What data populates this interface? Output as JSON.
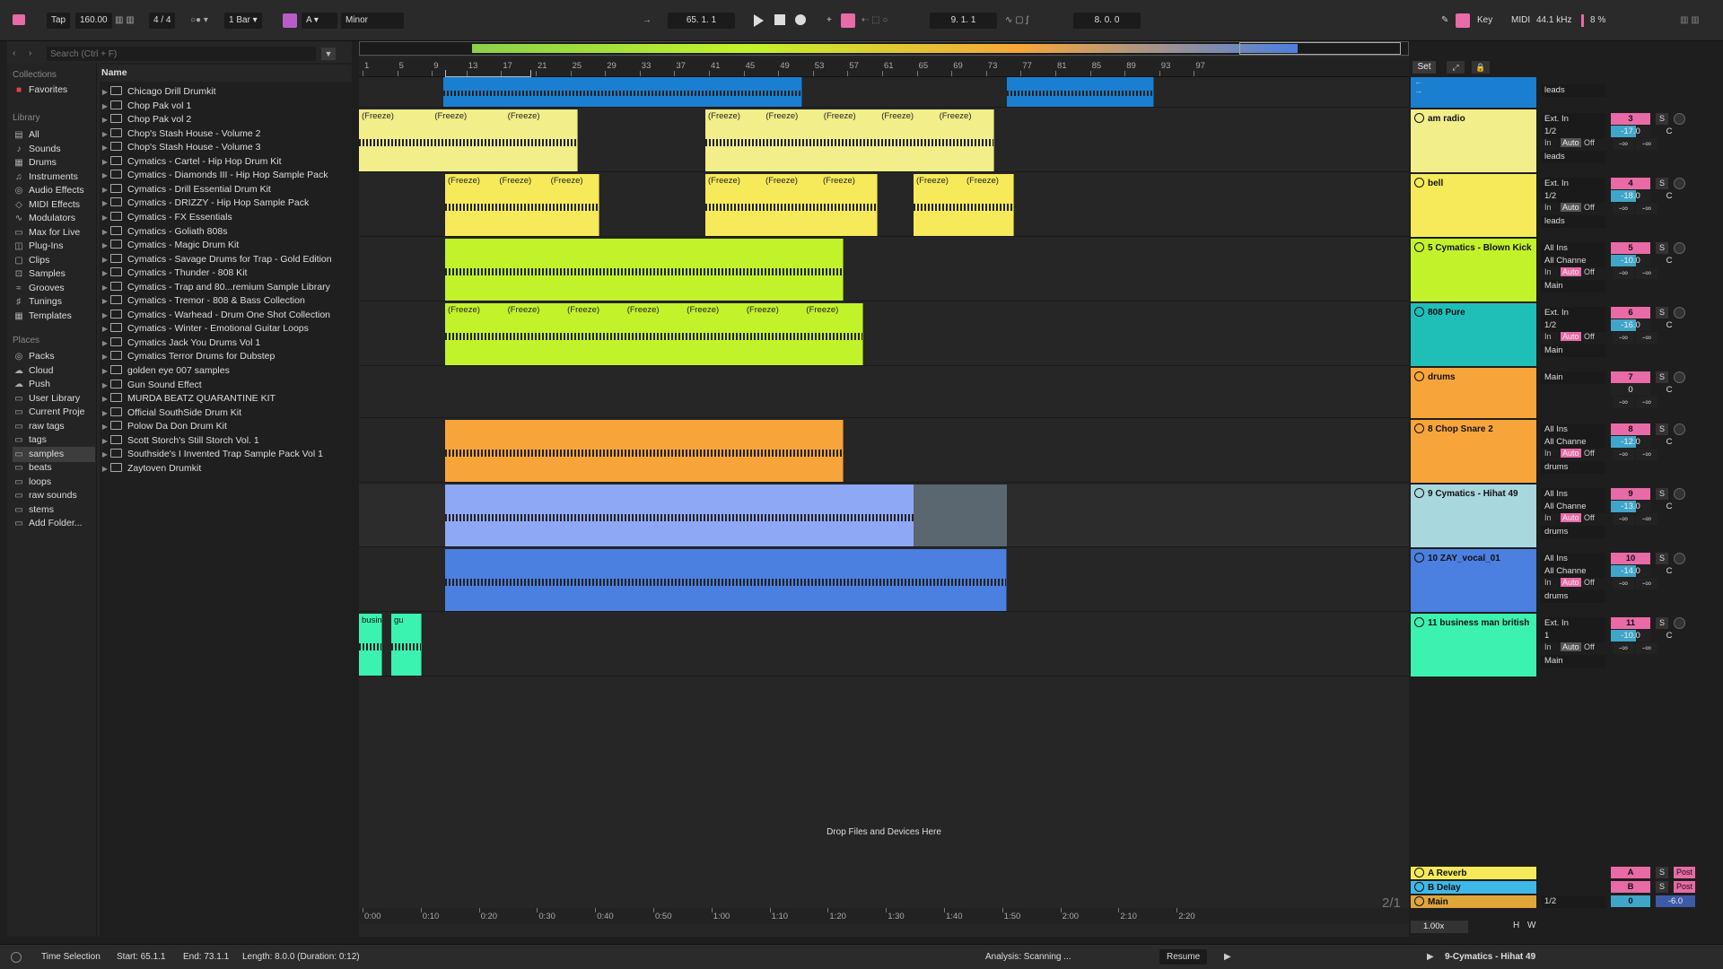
{
  "transport": {
    "tap": "Tap",
    "tempo": "160.00",
    "time_sig": "4 / 4",
    "quantize": "1 Bar",
    "key_root": "A",
    "scale": "Minor",
    "position": "65. 1. 1",
    "loop_start": "9. 1. 1",
    "loop_length": "8. 0. 0",
    "key_label": "Key",
    "midi_label": "MIDI",
    "sample_rate": "44.1 kHz",
    "cpu": "8 %"
  },
  "browser": {
    "search_placeholder": "Search (Ctrl + F)",
    "collections_title": "Collections",
    "favorites": "Favorites",
    "library_title": "Library",
    "library": [
      "All",
      "Sounds",
      "Drums",
      "Instruments",
      "Audio Effects",
      "MIDI Effects",
      "Modulators",
      "Max for Live",
      "Plug-Ins",
      "Clips",
      "Samples",
      "Grooves",
      "Tunings",
      "Templates"
    ],
    "places_title": "Places",
    "places": [
      "Packs",
      "Cloud",
      "Push",
      "User Library",
      "Current Proje",
      "raw tags",
      "tags",
      "samples",
      "beats",
      "loops",
      "raw sounds",
      "stems",
      "Add Folder..."
    ],
    "name_col": "Name",
    "files": [
      "Chicago Drill Drumkit",
      "Chop Pak vol 1",
      "Chop Pak vol 2",
      "Chop's Stash House - Volume 2",
      "Chop's Stash House - Volume 3",
      "Cymatics - Cartel - Hip Hop Drum Kit",
      "Cymatics - Diamonds III - Hip Hop Sample Pack",
      "Cymatics - Drill Essential Drum Kit",
      "Cymatics - DRIZZY - Hip Hop Sample Pack",
      "Cymatics - FX Essentials",
      "Cymatics - Goliath 808s",
      "Cymatics - Magic Drum Kit",
      "Cymatics - Savage Drums for Trap - Gold Edition",
      "Cymatics - Thunder - 808 Kit",
      "Cymatics - Trap and 80...remium Sample Library",
      "Cymatics - Tremor - 808 & Bass Collection",
      "Cymatics - Warhead - Drum One Shot Collection",
      "Cymatics - Winter - Emotional Guitar Loops",
      "Cymatics Jack You Drums Vol 1",
      "Cymatics Terror Drums for Dubstep",
      "golden eye 007 samples",
      "Gun Sound Effect",
      "MURDA BEATZ QUARANTINE KIT",
      "Official SouthSide Drum Kit",
      "Polow Da Don Drum Kit",
      "Scott Storch's Still Storch Vol. 1",
      "Southside's I Invented Trap Sample Pack Vol 1",
      "Zaytoven Drumkit"
    ]
  },
  "ruler_bars": [
    "1",
    "5",
    "9",
    "13",
    "17",
    "21",
    "25",
    "29",
    "33",
    "37",
    "41",
    "45",
    "49",
    "53",
    "57",
    "61",
    "65",
    "69",
    "73",
    "77",
    "81",
    "85",
    "89",
    "93",
    "97"
  ],
  "time_labels": [
    "0:00",
    "0:10",
    "0:20",
    "0:30",
    "0:40",
    "0:50",
    "1:00",
    "1:10",
    "1:20",
    "1:30",
    "1:40",
    "1:50",
    "2:00",
    "2:10",
    "2:20"
  ],
  "freeze_label": "(Freeze)",
  "drop_text": "Drop Files and Devices Here",
  "set_label": "Set",
  "tracks": [
    {
      "name": "",
      "color": "#1a7fd0",
      "input": "",
      "channel": "",
      "route": "leads",
      "num": "",
      "vol": "",
      "pan": ""
    },
    {
      "name": "am radio",
      "color": "#f2ee8a",
      "input": "Ext. In",
      "channel": "1/2",
      "route": "leads",
      "num": "3",
      "vol": "-17.0",
      "pan": "C"
    },
    {
      "name": "bell",
      "color": "#f6ea5a",
      "input": "Ext. In",
      "channel": "1/2",
      "route": "leads",
      "num": "4",
      "vol": "-18.0",
      "pan": "C"
    },
    {
      "name": "5 Cymatics - Blown Kick",
      "color": "#c2f22a",
      "input": "All Ins",
      "channel": "All Channe",
      "route": "Main",
      "num": "5",
      "vol": "-10.0",
      "pan": "C"
    },
    {
      "name": "808 Pure",
      "color": "#1fbfb8",
      "input": "Ext. In",
      "channel": "1/2",
      "route": "Main",
      "num": "6",
      "vol": "-16.0",
      "pan": "C"
    },
    {
      "name": "drums",
      "color": "#f7a53a",
      "input": "Main",
      "channel": "",
      "route": "",
      "num": "7",
      "vol": "0",
      "pan": "C"
    },
    {
      "name": "8 Chop Snare 2",
      "color": "#f7a53a",
      "input": "All Ins",
      "channel": "All Channe",
      "route": "drums",
      "num": "8",
      "vol": "-12.0",
      "pan": "C"
    },
    {
      "name": "9 Cymatics - Hihat 49",
      "color": "#a9d7de",
      "input": "All Ins",
      "channel": "All Channe",
      "route": "drums",
      "num": "9",
      "vol": "-13.0",
      "pan": "C"
    },
    {
      "name": "10 ZAY_vocal_01",
      "color": "#4b7fe0",
      "input": "All Ins",
      "channel": "All Channe",
      "route": "drums",
      "num": "10",
      "vol": "-14.0",
      "pan": "C"
    },
    {
      "name": "11 business man british",
      "color": "#3cf2b0",
      "input": "Ext. In",
      "channel": "1",
      "route": "Main",
      "num": "11",
      "vol": "-10.0",
      "pan": "C"
    }
  ],
  "returns": [
    {
      "name": "A Reverb",
      "color": "#f6ea5a",
      "num": "A",
      "post": "Post"
    },
    {
      "name": "B Delay",
      "color": "#3fb8e8",
      "num": "B",
      "post": "Post"
    },
    {
      "name": "Main",
      "color": "#e0a63a",
      "channel": "1/2",
      "num": "0",
      "vol": "-6.0"
    }
  ],
  "clip_names": {
    "busin": "busin",
    "gu": "gu"
  },
  "labels": {
    "in": "In",
    "auto": "Auto",
    "off": "Off",
    "s": "S",
    "inf": "-∞",
    "zoom": "1.00x",
    "h": "H",
    "w": "W",
    "page": "2/1"
  },
  "status": {
    "mode": "Time Selection",
    "start": "Start: 65.1.1",
    "end": "End: 73.1.1",
    "length": "Length: 8.0.0 (Duration: 0:12)",
    "analysis": "Analysis: Scanning ...",
    "resume": "Resume",
    "selected_track": "9-Cymatics - Hihat 49"
  }
}
